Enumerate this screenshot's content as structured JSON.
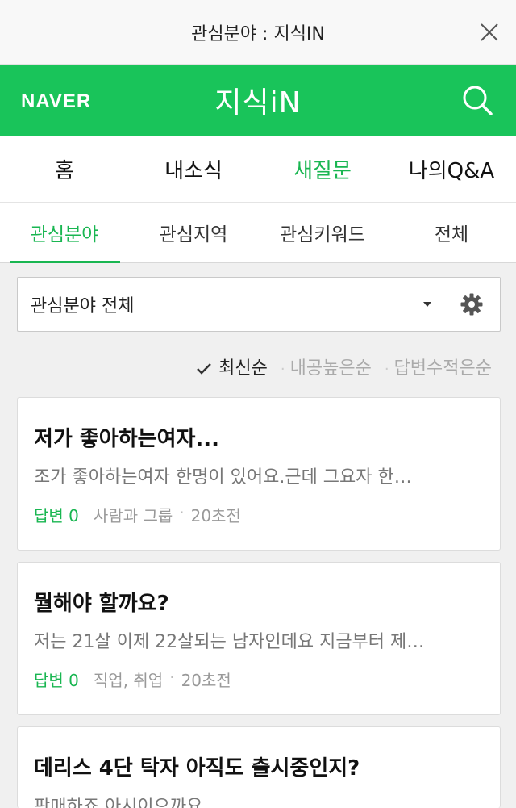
{
  "window": {
    "title": "관심분야 : 지식IN"
  },
  "header": {
    "logo": "NAVER",
    "brand": "지식iN"
  },
  "mainnav": {
    "items": [
      "홈",
      "내소식",
      "새질문",
      "나의Q&A"
    ],
    "active_index": 2
  },
  "subtabs": {
    "items": [
      "관심분야",
      "관심지역",
      "관심키워드",
      "전체"
    ],
    "active_index": 0
  },
  "filter": {
    "selected": "관심분야 전체"
  },
  "sort": {
    "options": [
      "최신순",
      "내공높은순",
      "답변수적은순"
    ],
    "active_index": 0
  },
  "questions": [
    {
      "title": "저가 좋아하는여자...",
      "body": "조가 좋아하는여자 한명이 있어요.근데 그요자 한…",
      "answers": "답변 0",
      "category": "사람과 그룹",
      "time": "20초전"
    },
    {
      "title": "뭘해야 할까요?",
      "body": "저는 21살 이제 22살되는 남자인데요 지금부터 제…",
      "answers": "답변 0",
      "category": "직업, 취업",
      "time": "20초전"
    },
    {
      "title": "데리스 4단 탁자 아직도 출시중인지?",
      "body": "판매하죠 아시이으까요",
      "answers": "",
      "category": "",
      "time": ""
    }
  ],
  "colors": {
    "accent": "#19c45a",
    "accent_text": "#19b651"
  }
}
